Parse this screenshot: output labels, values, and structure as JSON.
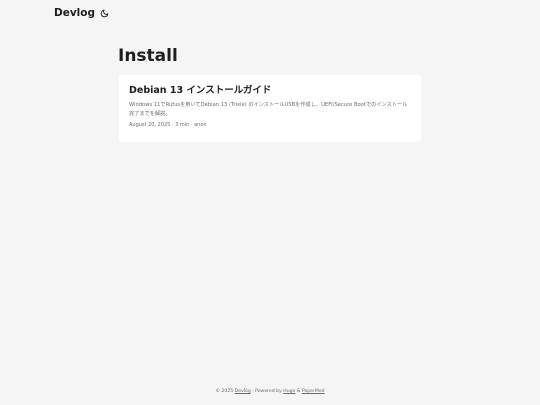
{
  "header": {
    "logo": "Devlog",
    "theme_icon": "moon-icon"
  },
  "main": {
    "title": "Install",
    "posts": [
      {
        "title": "Debian 13 インストールガイド",
        "summary": "Windows 11でRufusを用いてDebian 13 (Trixie) のインストールUSBを作成し、UEFI/Secure Bootでのインストール完了までを解説。",
        "meta": "August 20, 2025 · 3 min · anon"
      }
    ]
  },
  "footer": {
    "copyright": "© 2025",
    "site_link": "Devlog",
    "powered_by": "· Powered by",
    "hugo_link": "Hugo",
    "amp": "&",
    "papermod_link": "PaperMod"
  }
}
